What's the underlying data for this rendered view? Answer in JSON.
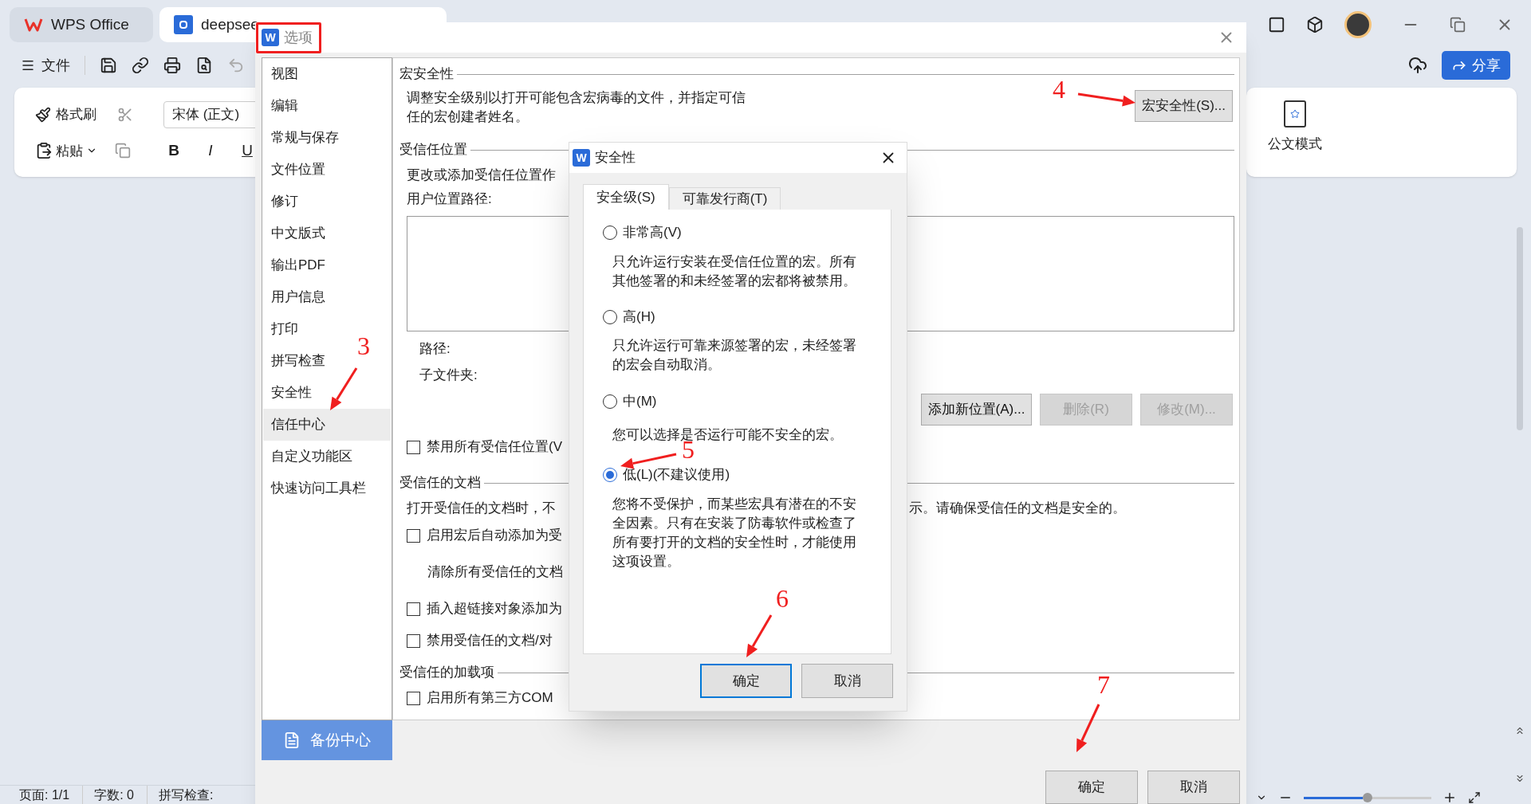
{
  "app": {
    "tabs": [
      {
        "label": "WPS Office",
        "kind": "home",
        "selected": false
      },
      {
        "label": "deepsee",
        "kind": "document",
        "selected": true
      }
    ],
    "menu": "文件",
    "ribbon": {
      "format_painter": "格式刷",
      "paste": "粘贴",
      "font": "宋体 (正文)",
      "bold": "B",
      "italic": "I",
      "underline": "U",
      "official_mode": "公文模式"
    },
    "share": "分享",
    "zoom": {
      "level": 0.5
    },
    "status_bar": [
      "页面: 1/1",
      "字数: 0",
      "拼写检查:"
    ]
  },
  "options_dialog": {
    "icon_letter": "W",
    "title": "选项",
    "title_highlighted": true,
    "sidebar": {
      "items": [
        {
          "label": "视图",
          "selected": false
        },
        {
          "label": "编辑",
          "selected": false
        },
        {
          "label": "常规与保存",
          "selected": false
        },
        {
          "label": "文件位置",
          "selected": false
        },
        {
          "label": "修订",
          "selected": false
        },
        {
          "label": "中文版式",
          "selected": false
        },
        {
          "label": "输出PDF",
          "selected": false
        },
        {
          "label": "用户信息",
          "selected": false
        },
        {
          "label": "打印",
          "selected": false
        },
        {
          "label": "拼写检查",
          "selected": false
        },
        {
          "label": "安全性",
          "selected": false
        },
        {
          "label": "信任中心",
          "selected": true
        },
        {
          "label": "自定义功能区",
          "selected": false
        },
        {
          "label": "快速访问工具栏",
          "selected": false
        }
      ],
      "backup": "备份中心"
    },
    "macro_security": {
      "heading": "宏安全性",
      "description": "调整安全级别以打开可能包含宏病毒的文件，并指定可信任的宏创建者姓名。",
      "button": "宏安全性(S)..."
    },
    "trusted_locations": {
      "heading": "受信任位置",
      "description": "更改或添加受信任位置作",
      "path_list_label": "用户位置路径:",
      "path_label": "路径:",
      "subfolder_label": "子文件夹:",
      "buttons": [
        {
          "label": "添加新位置(A)...",
          "disabled": false
        },
        {
          "label": "删除(R)",
          "disabled": true
        },
        {
          "label": "修改(M)...",
          "disabled": true
        }
      ],
      "checkbox": {
        "label": "禁用所有受信任位置(V",
        "checked": false
      }
    },
    "trusted_documents": {
      "heading": "受信任的文档",
      "description": "打开受信任的文档时，不",
      "description_tail": "示。请确保受信任的文档是安全的。",
      "items": [
        {
          "kind": "checkbox",
          "label": "启用宏后自动添加为受",
          "checked": false
        },
        {
          "kind": "action",
          "label": "清除所有受信任的文档"
        },
        {
          "kind": "checkbox",
          "label": "插入超链接对象添加为",
          "checked": false
        },
        {
          "kind": "checkbox",
          "label": "禁用受信任的文档/对",
          "checked": false
        }
      ]
    },
    "trusted_addins": {
      "heading": "受信任的加载项",
      "checkbox": {
        "label": "启用所有第三方COM",
        "checked": false
      }
    },
    "buttons": [
      {
        "label": "确定"
      },
      {
        "label": "取消"
      }
    ]
  },
  "security_dialog": {
    "icon_letter": "W",
    "title": "安全性",
    "tabs": [
      {
        "label": "安全级(S)",
        "selected": true
      },
      {
        "label": "可靠发行商(T)",
        "selected": false
      }
    ],
    "levels": [
      {
        "label": "非常高(V)",
        "description": "只允许运行安装在受信任位置的宏。所有其他签署的和未经签署的宏都将被禁用。",
        "selected": false
      },
      {
        "label": "高(H)",
        "description": "只允许运行可靠来源签署的宏，未经签署的宏会自动取消。",
        "selected": false
      },
      {
        "label": "中(M)",
        "description": "您可以选择是否运行可能不安全的宏。",
        "selected": false
      },
      {
        "label": "低(L)(不建议使用)",
        "description": "您将不受保护，而某些宏具有潜在的不安全因素。只有在安装了防毒软件或检查了所有要打开的文档的安全性时，才能使用这项设置。",
        "selected": true
      }
    ],
    "buttons": [
      {
        "label": "确定",
        "default": true
      },
      {
        "label": "取消",
        "default": false
      }
    ]
  },
  "annotations": [
    {
      "label": "3"
    },
    {
      "label": "4"
    },
    {
      "label": "5"
    },
    {
      "label": "6"
    },
    {
      "label": "7"
    }
  ]
}
